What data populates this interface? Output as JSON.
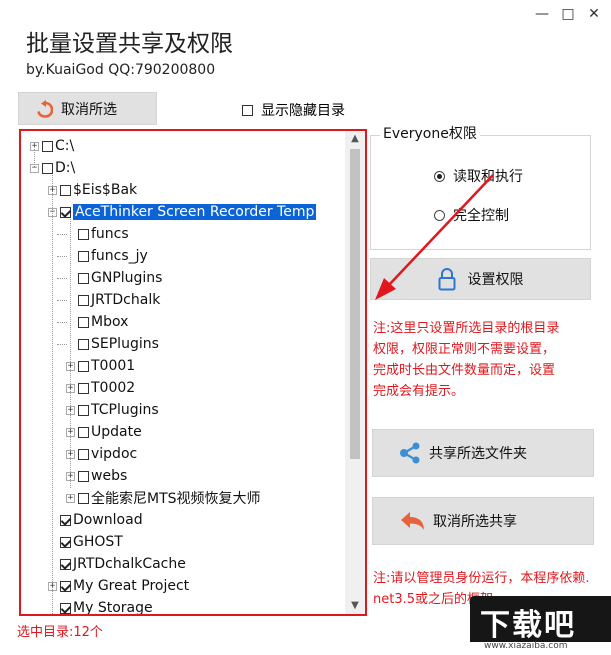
{
  "window": {
    "minimize": "—",
    "maximize": "□",
    "close": "✕"
  },
  "app": {
    "title": "批量设置共享及权限",
    "author": "by.KuaiGod  QQ:790200800"
  },
  "toolbar": {
    "deselect_label": "取消所选",
    "show_hidden_label": "显示隐藏目录",
    "show_hidden_checked": false
  },
  "tree": {
    "items": [
      {
        "label": "C:\\",
        "checked": false,
        "expander": "+"
      },
      {
        "label": "D:\\",
        "checked": false,
        "expander": "−"
      },
      {
        "label": "$Eis$Bak",
        "checked": false,
        "expander": "+"
      },
      {
        "label": "AceThinker Screen Recorder Temp",
        "checked": true,
        "expander": "−",
        "selected": true
      },
      {
        "label": "funcs",
        "checked": false
      },
      {
        "label": "funcs_jy",
        "checked": false
      },
      {
        "label": "GNPlugins",
        "checked": false
      },
      {
        "label": "JRTDchalk",
        "checked": false
      },
      {
        "label": "Mbox",
        "checked": false
      },
      {
        "label": "SEPlugins",
        "checked": false
      },
      {
        "label": "T0001",
        "checked": false,
        "expander": "+"
      },
      {
        "label": "T0002",
        "checked": false,
        "expander": "+"
      },
      {
        "label": "TCPlugins",
        "checked": false,
        "expander": "+"
      },
      {
        "label": "Update",
        "checked": false,
        "expander": "+"
      },
      {
        "label": "vipdoc",
        "checked": false,
        "expander": "+"
      },
      {
        "label": "webs",
        "checked": false,
        "expander": "+"
      },
      {
        "label": "全能索尼MTS视频恢复大师",
        "checked": false,
        "expander": "+"
      },
      {
        "label": "Download",
        "checked": true
      },
      {
        "label": "GHOST",
        "checked": true
      },
      {
        "label": "JRTDchalkCache",
        "checked": true
      },
      {
        "label": "My Great Project",
        "checked": true,
        "expander": "+"
      },
      {
        "label": "My Storage",
        "checked": true
      }
    ]
  },
  "permissions": {
    "group_title": "Everyone权限",
    "options": [
      {
        "label": "读取和执行",
        "selected": true
      },
      {
        "label": "完全控制",
        "selected": false
      }
    ],
    "set_button": "设置权限"
  },
  "notes": {
    "permission_note": [
      "注:这里只设置所选目录的根目录",
      "权限，权限正常则不需要设置，",
      "完成时长由文件数量而定，设置",
      "完成会有提示。"
    ],
    "admin_note": [
      "注:请以管理员身份运行，本程序依赖.",
      "net3.5或之后的框架"
    ]
  },
  "actions": {
    "share_button": "共享所选文件夹",
    "unshare_button": "取消所选共享"
  },
  "status": {
    "selected_count": "选中目录:12个"
  },
  "watermark": {
    "brand": "下载吧",
    "url": "www.xiazaiba.com"
  },
  "colors": {
    "accent_red": "#e0181e",
    "selection_blue": "#0a64d8",
    "button_gray": "#e1e1e1",
    "share_icon": "#3a8fd6",
    "undo_icon": "#e8633c",
    "lock_icon": "#2f76d2"
  }
}
